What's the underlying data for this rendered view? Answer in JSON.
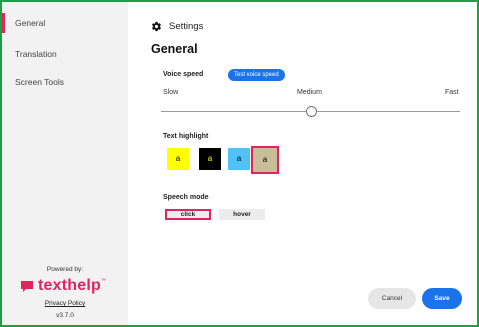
{
  "sidebar": {
    "items": [
      {
        "label": "General",
        "active": true
      },
      {
        "label": "Translation",
        "active": false
      },
      {
        "label": "Screen Tools",
        "active": false
      }
    ],
    "powered_by": "Powered by:",
    "brand": "texthelp",
    "brand_tm": "™",
    "privacy": "Privacy Policy",
    "version": "v3.7.0"
  },
  "header": {
    "settings_title": "Settings",
    "section_title": "General"
  },
  "voice": {
    "label": "Voice speed",
    "test_label": "Test voice speed",
    "slow": "Slow",
    "medium": "Medium",
    "fast": "Fast",
    "level": 0.5
  },
  "highlight": {
    "label": "Text highlight",
    "swatches": [
      {
        "text": "a",
        "bg": "#ffff00",
        "fg": "#000000"
      },
      {
        "text": "a",
        "bg": "#000000",
        "fg": "#ffff00"
      },
      {
        "text": "a",
        "bg": "#4fc3f7",
        "fg": "#000000"
      },
      {
        "text": "a",
        "bg": "#c8bf9a",
        "fg": "#000000",
        "selected": true
      }
    ]
  },
  "speech": {
    "label": "Speech mode",
    "click": "click",
    "hover": "hover",
    "selected": "click"
  },
  "actions": {
    "cancel": "Cancel",
    "save": "Save"
  },
  "colors": {
    "accent": "#1a73e8",
    "brand": "#e0245e",
    "frame": "#1f9e4a"
  }
}
